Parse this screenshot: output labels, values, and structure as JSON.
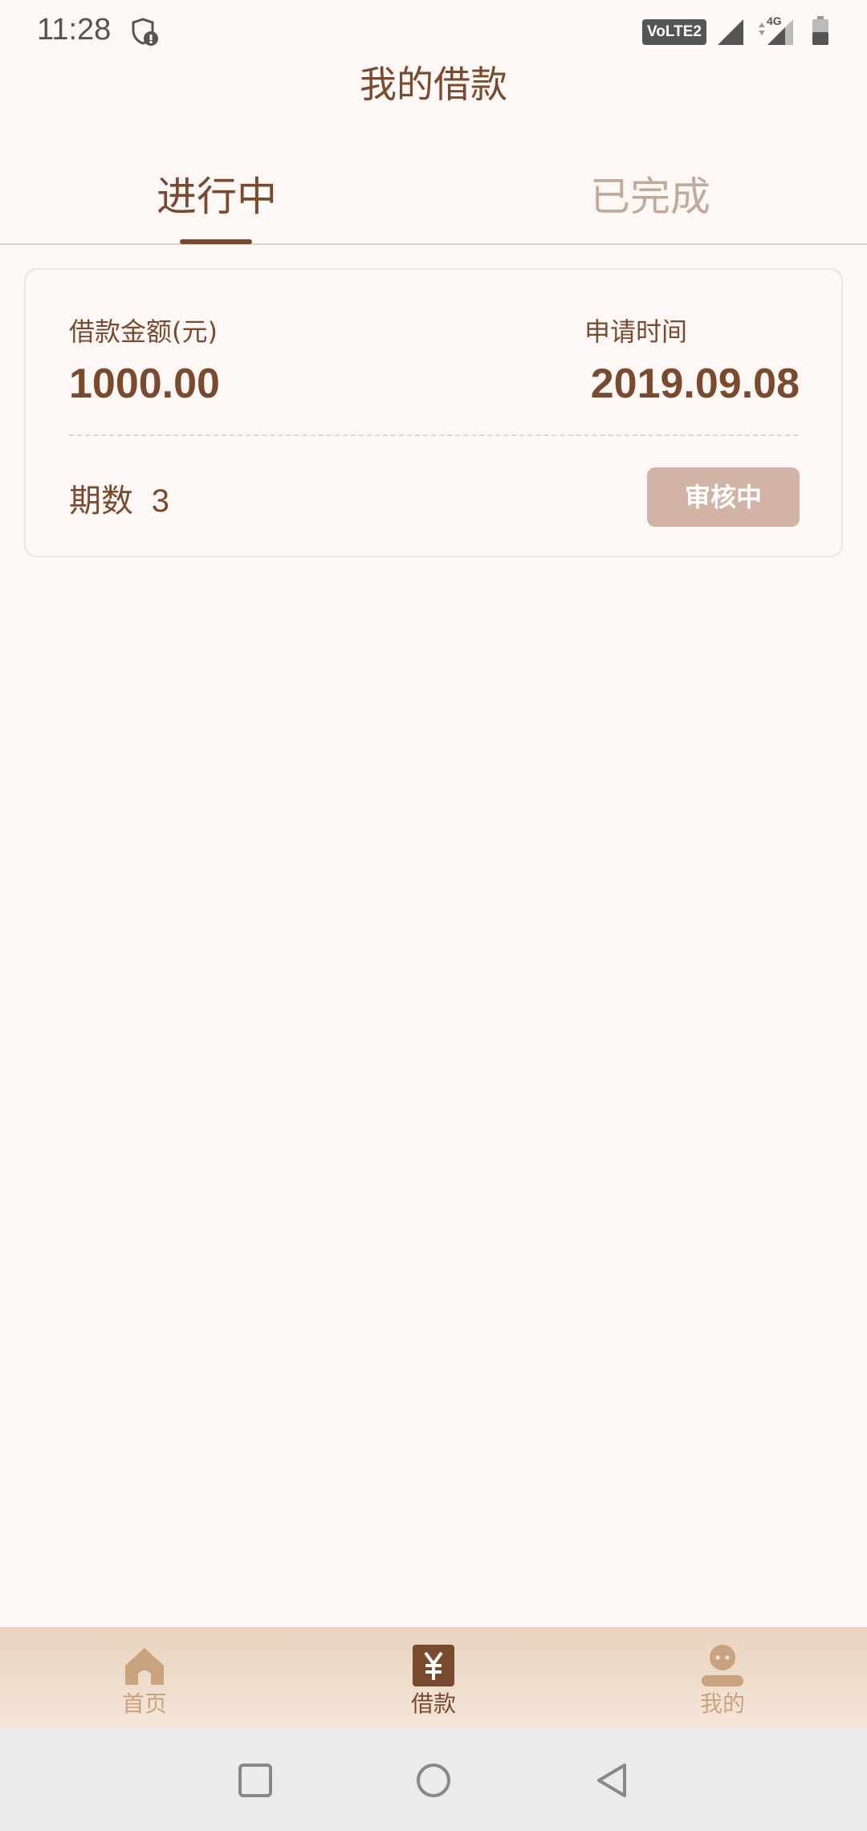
{
  "status_bar": {
    "time": "11:28",
    "volte": "VoLTE2",
    "network": "4G",
    "icons": [
      "shield-icon",
      "signal-icon",
      "battery-icon"
    ]
  },
  "header": {
    "title": "我的借款"
  },
  "tabs": [
    {
      "label": "进行中",
      "active": true
    },
    {
      "label": "已完成",
      "active": false
    }
  ],
  "loan": {
    "amount_label": "借款金额(元)",
    "amount_value": "1000.00",
    "time_label": "申请时间",
    "time_value": "2019.09.08",
    "periods_label": "期数",
    "periods_value": "3",
    "status_label": "审核中"
  },
  "bottom_nav": [
    {
      "label": "首页",
      "icon": "home-icon",
      "active": false
    },
    {
      "label": "借款",
      "icon": "yen-icon",
      "active": true
    },
    {
      "label": "我的",
      "icon": "user-icon",
      "active": false
    }
  ],
  "system_nav": [
    "recent-apps-icon",
    "home-circle-icon",
    "back-triangle-icon"
  ],
  "colors": {
    "background": "#fdf8f5",
    "primary": "#7a4a2e",
    "inactive_tab": "#c2aa98",
    "status_button": "#d2b4a6",
    "nav_inactive": "#c9a37f"
  }
}
